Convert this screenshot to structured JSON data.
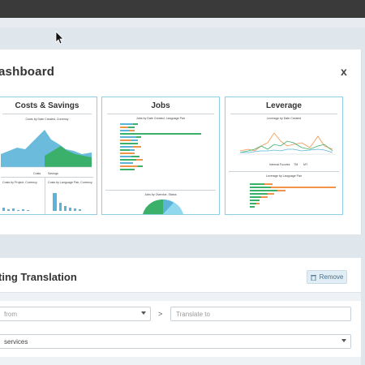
{
  "dashboard": {
    "title": "ashboard",
    "close_label": "x",
    "cards": [
      {
        "title": "Costs & Savings",
        "sub_main": "Costs by Date Created, Currency",
        "legend_a": "Costs",
        "legend_b": "Savings",
        "sub_left": "Costs by Project, Currency",
        "sub_right": "Costs by Language Pair, Currency"
      },
      {
        "title": "Jobs",
        "sub_main": "Jobs by Date Created, Language Pair",
        "sub_bottom": "Jobs by Overdue, Status"
      },
      {
        "title": "Leverage",
        "sub_main": "Leverage by Date Created",
        "legend": [
          "Internal Fuzzies",
          "TM",
          "MT"
        ],
        "sub_bottom": "Leverage by Language Pair"
      }
    ]
  },
  "translation": {
    "title": "ting Translation",
    "remove_label": "Remove",
    "from_placeholder": "from",
    "arrow": ">",
    "to_placeholder": "Translate to",
    "services_value": "services"
  },
  "colors": {
    "accent": "#8fd0e4",
    "blue": "#5bb4d8",
    "green": "#3bb06b",
    "orange": "#f0944a"
  }
}
